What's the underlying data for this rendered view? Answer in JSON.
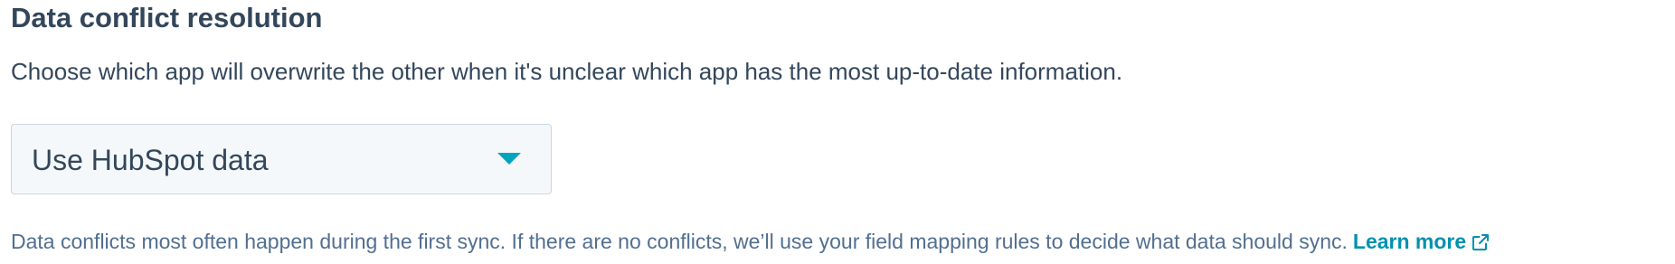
{
  "section": {
    "title": "Data conflict resolution",
    "description": "Choose which app will overwrite the other when it's unclear which app has the most up-to-date information."
  },
  "conflict_select": {
    "selected_value": "Use HubSpot data",
    "caret_icon": "chevron-down-icon"
  },
  "help": {
    "text": "Data conflicts most often happen during the first sync. If there are no conflicts, we’ll use your field mapping rules to decide what data should sync.",
    "link_label": "Learn more",
    "link_icon": "external-link-icon"
  },
  "colors": {
    "text_primary": "#33475b",
    "text_secondary": "#516f90",
    "accent": "#0091ae",
    "caret": "#00a4bd",
    "select_bg": "#f5f8fa",
    "select_border": "#cbd6e2"
  }
}
